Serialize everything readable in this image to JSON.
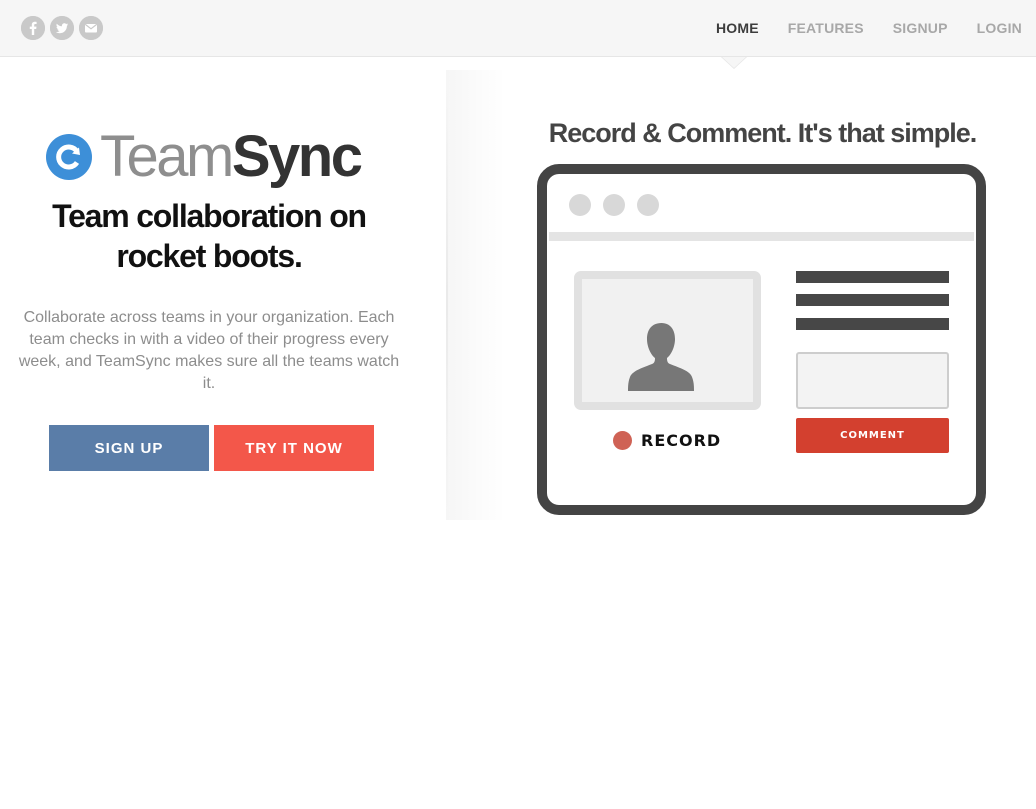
{
  "social": {
    "icons": [
      "facebook-icon",
      "twitter-icon",
      "email-icon"
    ]
  },
  "nav": {
    "items": [
      {
        "label": "HOME",
        "active": true
      },
      {
        "label": "FEATURES",
        "active": false
      },
      {
        "label": "SIGNUP",
        "active": false
      },
      {
        "label": "LOGIN",
        "active": false
      }
    ]
  },
  "hero": {
    "logo_team": "Team",
    "logo_sync": "Sync",
    "headline_line1": "Team collaboration on",
    "headline_line2": "rocket boots.",
    "description": "Collaborate across teams in your organization. Each team checks in with a video of their progress every week, and TeamSync makes sure all the teams watch it.",
    "signup_label": "SIGN UP",
    "try_label": "TRY IT NOW"
  },
  "illustration": {
    "tagline": "Record & Comment. It's that simple.",
    "record_label": "RECORD",
    "comment_label": "COMMENT"
  },
  "colors": {
    "brand_blue": "#3d8fd8",
    "signup_button": "#5a7da8",
    "try_button": "#f3574a",
    "comment_button": "#d3402f",
    "record_dot": "#cf6255"
  }
}
